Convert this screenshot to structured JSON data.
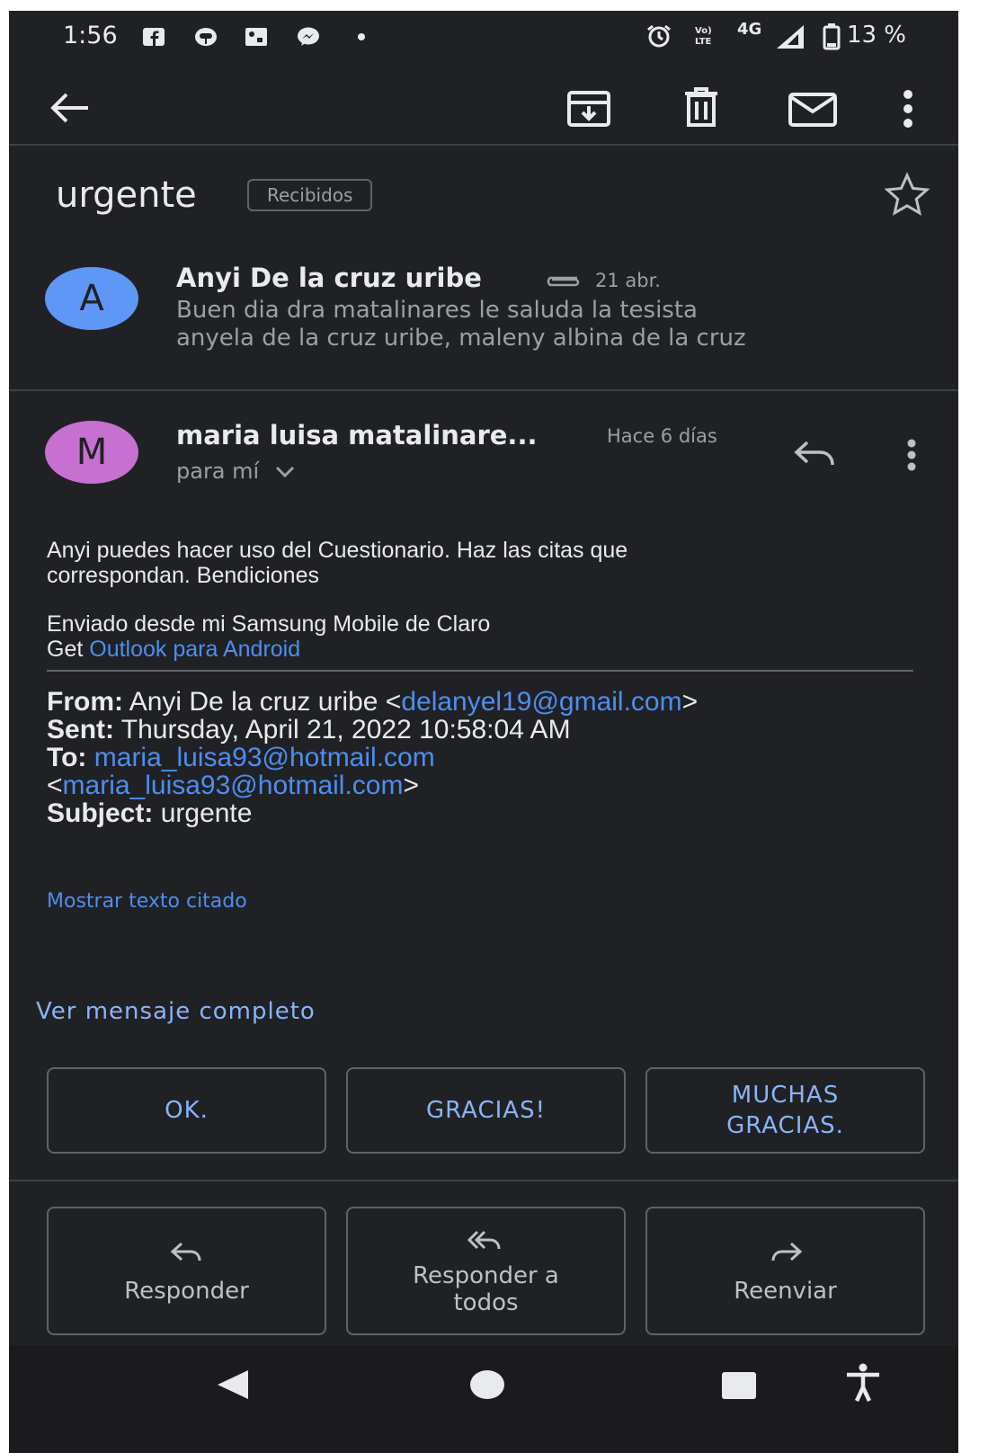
{
  "status_bar": {
    "time": "1:56",
    "battery": "13 %",
    "network": "4G",
    "icons": [
      "facebook-icon",
      "pinterest-icon",
      "gallery-icon",
      "messenger-icon",
      "notification-dot-icon",
      "alarm-icon",
      "volte-icon",
      "signal-icon",
      "battery-icon"
    ]
  },
  "toolbar": {
    "icons": [
      "back-arrow-icon",
      "archive-icon",
      "delete-icon",
      "mark-unread-icon",
      "more-vert-icon"
    ]
  },
  "email": {
    "subject": "urgente",
    "label": "Recibidos"
  },
  "collapsed_message": {
    "avatar_letter": "A",
    "avatar_color": "#5e97f6",
    "sender": "Anyi De la cruz uribe",
    "date": "21 abr.",
    "snippet_line1": "Buen dia dra matalinares le saluda la tesista",
    "snippet_line2": "anyela de la cruz uribe, maleny albina de la cruz"
  },
  "open_message": {
    "avatar_letter": "M",
    "avatar_color": "#c670d0",
    "sender": "maria luisa matalinare...",
    "time_ago": "Hace 6 días",
    "recipient": "para mí",
    "body_line1": "Anyi puedes hacer uso del Cuestionario. Haz las citas que",
    "body_line2": "correspondan. Bendiciones",
    "signature_line1": "Enviado desde mi Samsung Mobile de Claro",
    "signature_get": "Get",
    "signature_link": "Outlook para Android",
    "from_label": "From:",
    "from_name": "Anyi De la cruz uribe <",
    "from_email": "delanyel19@gmail.com",
    "from_close": ">",
    "sent_label": "Sent:",
    "sent_value": "Thursday, April 21, 2022 10:58:04 AM",
    "to_label": "To:",
    "to_email": "maria_luisa93@hotmail.com",
    "to_open": "<",
    "to_email2": "maria_luisa93@hotmail.com",
    "to_close": ">",
    "subject_label": "Subject:",
    "subject_value": "urgente",
    "show_quoted": "Mostrar texto citado",
    "view_full": "Ver mensaje completo"
  },
  "smart_replies": {
    "r1": "OK.",
    "r2": "GRACIAS!",
    "r3_line1": "MUCHAS",
    "r3_line2": "GRACIAS."
  },
  "actions": {
    "reply": "Responder",
    "reply_all_line1": "Responder a",
    "reply_all_line2": "todos",
    "forward": "Reenviar"
  },
  "nav_bar": {
    "icons": [
      "nav-back-icon",
      "nav-home-icon",
      "nav-recents-icon",
      "accessibility-icon"
    ]
  }
}
